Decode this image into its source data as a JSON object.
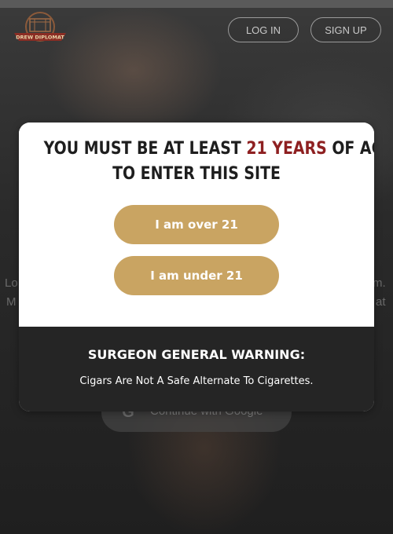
{
  "header": {
    "logo_text": "DREW DIPLOMAT",
    "login_label": "LOG IN",
    "signup_label": "SIGN UP"
  },
  "background": {
    "left_text_1": "Lo",
    "left_text_2": "M",
    "right_text_1": "m.",
    "right_text_2": "at",
    "google_button_label": "Continue with Google"
  },
  "age_gate": {
    "heading_part1": "YOU MUST BE AT LEAST ",
    "heading_highlight": "21 YEARS",
    "heading_part2": " OF AGE",
    "heading_line2": "TO ENTER THIS SITE",
    "over_button": "I am over 21",
    "under_button": "I am under 21",
    "warning_title": "SURGEON GENERAL WARNING:",
    "warning_text": "Cigars Are Not A Safe Alternate To Cigarettes."
  },
  "colors": {
    "accent_gold": "#c9a462",
    "highlight_red": "#8e2021",
    "warning_bg": "#252525"
  }
}
